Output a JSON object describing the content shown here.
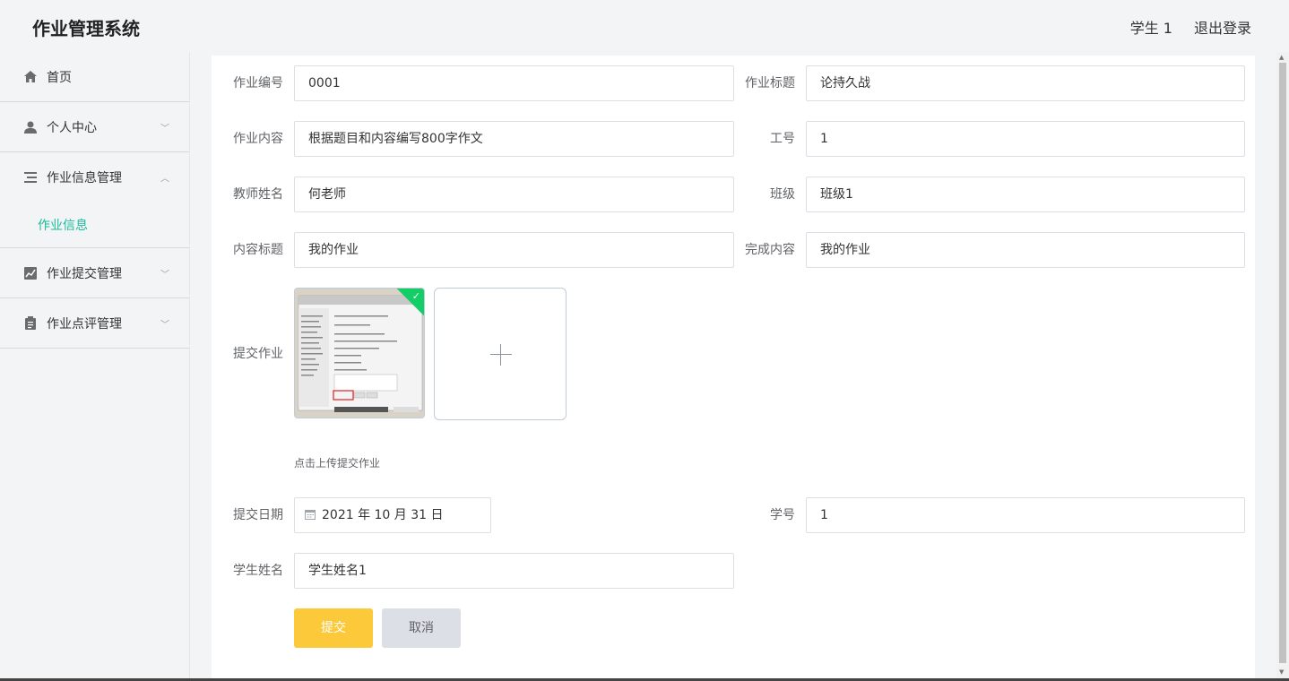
{
  "app": {
    "title": "作业管理系统"
  },
  "header": {
    "user": "学生 1",
    "logout": "退出登录"
  },
  "sidebar": {
    "items": [
      {
        "label": "首页",
        "icon": "home-icon"
      },
      {
        "label": "个人中心",
        "icon": "user-icon",
        "expanded": false
      },
      {
        "label": "作业信息管理",
        "icon": "list-icon",
        "expanded": true,
        "children": [
          {
            "label": "作业信息",
            "active": true
          }
        ]
      },
      {
        "label": "作业提交管理",
        "icon": "chart-icon",
        "expanded": false
      },
      {
        "label": "作业点评管理",
        "icon": "clipboard-icon",
        "expanded": false
      }
    ]
  },
  "form": {
    "homework_no": {
      "label": "作业编号",
      "value": "0001"
    },
    "homework_title": {
      "label": "作业标题",
      "value": "论持久战"
    },
    "homework_content": {
      "label": "作业内容",
      "value": "根据题目和内容编写800字作文"
    },
    "staff_no": {
      "label": "工号",
      "value": "1"
    },
    "teacher_name": {
      "label": "教师姓名",
      "value": "何老师"
    },
    "class": {
      "label": "班级",
      "value": "班级1"
    },
    "content_title": {
      "label": "内容标题",
      "value": "我的作业"
    },
    "completed_content": {
      "label": "完成内容",
      "value": "我的作业"
    },
    "upload": {
      "label": "提交作业",
      "hint": "点击上传提交作业"
    },
    "submit_date": {
      "label": "提交日期",
      "value": "2021 年 10 月 31 日"
    },
    "student_no": {
      "label": "学号",
      "value": "1"
    },
    "student_name": {
      "label": "学生姓名",
      "value": "学生姓名1"
    }
  },
  "actions": {
    "submit": "提交",
    "cancel": "取消"
  },
  "colors": {
    "accent": "#1abc9c",
    "submit": "#fcc93a",
    "success": "#13ce66"
  }
}
